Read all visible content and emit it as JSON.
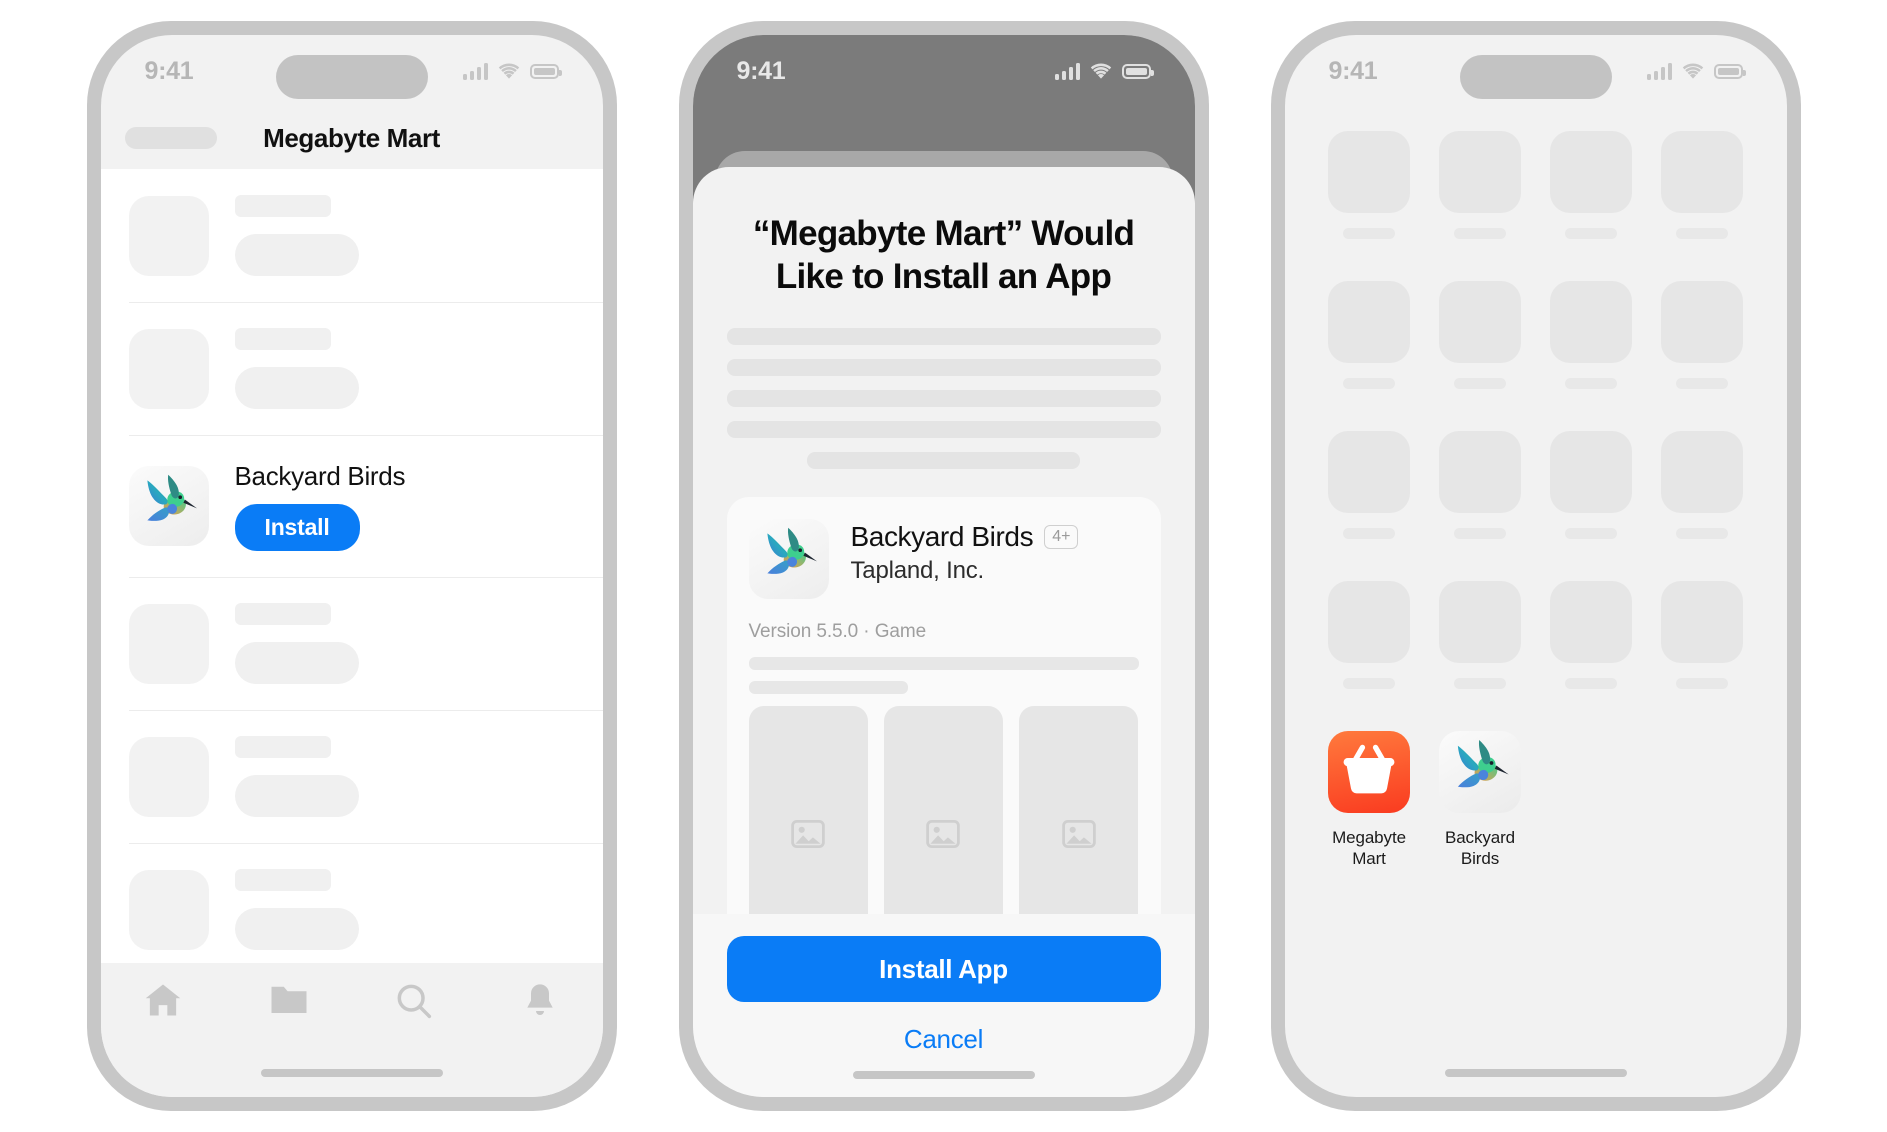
{
  "status_bar": {
    "time": "9:41",
    "signal_icon": "cellular-signal-icon",
    "wifi_icon": "wifi-icon",
    "battery_icon": "battery-icon"
  },
  "phone_list": {
    "nav": {
      "title": "Megabyte Mart",
      "back_placeholder": true
    },
    "rows": [
      {
        "type": "placeholder"
      },
      {
        "type": "placeholder"
      },
      {
        "type": "app",
        "title": "Backyard Birds",
        "action_label": "Install",
        "icon": "hummingbird-icon"
      },
      {
        "type": "placeholder"
      },
      {
        "type": "placeholder"
      },
      {
        "type": "placeholder"
      }
    ],
    "tabs": [
      {
        "icon": "home-icon",
        "name": "tab-home"
      },
      {
        "icon": "folder-icon",
        "name": "tab-files"
      },
      {
        "icon": "search-icon",
        "name": "tab-search"
      },
      {
        "icon": "bell-icon",
        "name": "tab-notifications"
      }
    ]
  },
  "phone_sheet": {
    "title": "“Megabyte Mart” Would Like to Install an App",
    "description_lines": 4,
    "description_short_line": true,
    "app": {
      "name": "Backyard Birds",
      "age_rating": "4+",
      "developer": "Tapland, Inc.",
      "version_line": "Version 5.5.0 · Game",
      "icon": "hummingbird-icon",
      "description_lines": 2,
      "screenshots": [
        {
          "placeholder_icon": "image-placeholder-icon"
        },
        {
          "placeholder_icon": "image-placeholder-icon"
        },
        {
          "placeholder_icon": "image-placeholder-icon"
        }
      ]
    },
    "primary_action": "Install App",
    "secondary_action": "Cancel"
  },
  "phone_home": {
    "placeholder_rows": 4,
    "placeholder_columns": 4,
    "apps": [
      {
        "label": "Megabyte\nMart",
        "icon": "shopping-basket-icon"
      },
      {
        "label": "Backyard\nBirds",
        "icon": "hummingbird-icon"
      }
    ]
  },
  "colors": {
    "accent_blue": "#0a7cf6",
    "brand_red": "#fa3b20",
    "bezel": "#c7c7c7",
    "dim_overlay": "#7b7b7b"
  }
}
